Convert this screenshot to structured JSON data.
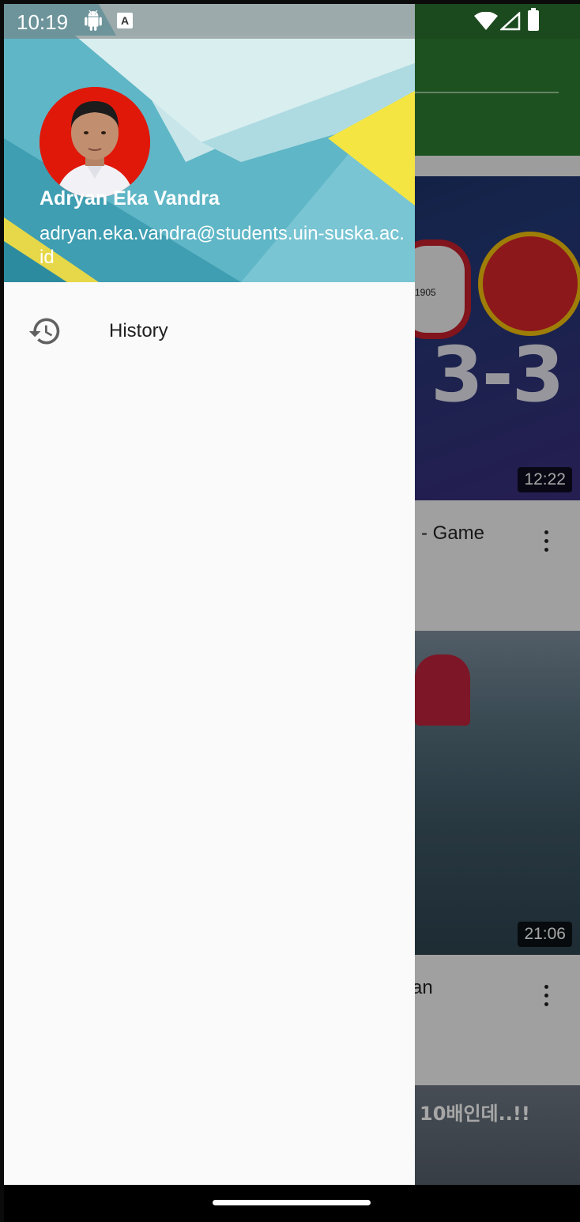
{
  "status_bar": {
    "time": "10:19",
    "icons": [
      "android-icon",
      "a-notification-icon",
      "wifi-icon",
      "signal-icon",
      "battery-icon"
    ],
    "notification_letter": "A"
  },
  "drawer": {
    "user": {
      "name": "Adryan Eka Vandra",
      "email": "adryan.eka.vandra@students.uin-suska.ac.id"
    },
    "menu": [
      {
        "label": "History",
        "icon": "history-icon"
      }
    ]
  },
  "background_feed": {
    "videos": [
      {
        "title_fragment": "l - Game",
        "duration": "12:22",
        "thumbnail_text": "3-3",
        "badge_text": "1905"
      },
      {
        "title_fragment": "an",
        "duration": "21:06"
      },
      {
        "thumbnail_text": "10배인데..!!"
      }
    ]
  },
  "colors": {
    "app_bar": "#2e7d32",
    "drawer_background": "#fafafa",
    "avatar_background": "#e0180a"
  }
}
